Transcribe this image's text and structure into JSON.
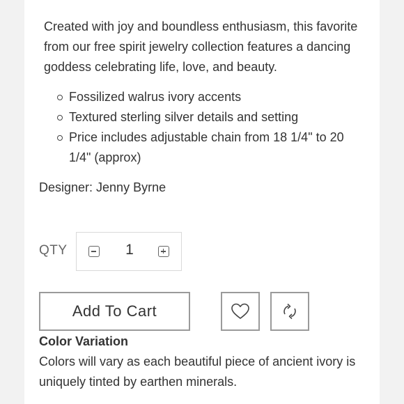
{
  "description": "Created with joy and boundless enthusiasm, this favorite from our free spirit jewelry collection features a dancing goddess celebrating life, love, and beauty.",
  "features": [
    "Fossilized walrus ivory accents",
    "Textured sterling silver details and setting",
    "Price includes adjustable chain from 18 1/4\" to 20 1/4\" (approx)"
  ],
  "designer": "Designer: Jenny Byrne",
  "quantity": {
    "label": "QTY",
    "value": "1",
    "decrement_icon": "minus-square-icon",
    "increment_icon": "plus-square-icon"
  },
  "actions": {
    "add_to_cart_label": "Add To Cart",
    "wishlist_icon": "heart-icon",
    "compare_icon": "refresh-icon"
  },
  "color_variation": {
    "title": "Color Variation",
    "text": "Colors will vary as each beautiful piece of ancient ivory is uniquely tinted by earthen minerals."
  },
  "colors": {
    "page_background": "#f2f2f2",
    "panel_background": "#ffffff",
    "text": "#333333",
    "border": "#9a9a9a"
  }
}
